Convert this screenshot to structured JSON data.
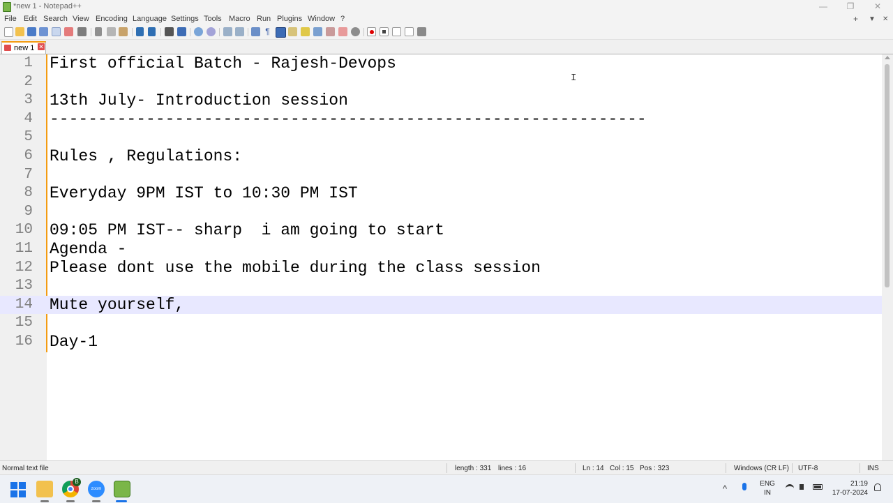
{
  "window": {
    "title": "*new 1 - Notepad++",
    "minimize": "—",
    "restore": "❐",
    "close": "✕"
  },
  "menu": {
    "items": [
      "File",
      "Edit",
      "Search",
      "View",
      "Encoding",
      "Language",
      "Settings",
      "Tools",
      "Macro",
      "Run",
      "Plugins",
      "Window",
      "?"
    ],
    "right_plus": "+",
    "right_down": "▼",
    "right_close": "✕"
  },
  "tabs": [
    {
      "label": "new 1",
      "close": "✕"
    }
  ],
  "editor": {
    "lines": [
      {
        "num": "1",
        "text": "First official Batch - Rajesh-Devops"
      },
      {
        "num": "2",
        "text": ""
      },
      {
        "num": "3",
        "text": "13th July- Introduction session"
      },
      {
        "num": "4",
        "text": "--------------------------------------------------------------"
      },
      {
        "num": "5",
        "text": ""
      },
      {
        "num": "6",
        "text": "Rules , Regulations:"
      },
      {
        "num": "7",
        "text": ""
      },
      {
        "num": "8",
        "text": "Everyday 9PM IST to 10:30 PM IST"
      },
      {
        "num": "9",
        "text": ""
      },
      {
        "num": "10",
        "text": "09:05 PM IST-- sharp  i am going to start"
      },
      {
        "num": "11",
        "text": "Agenda -"
      },
      {
        "num": "12",
        "text": "Please dont use the mobile during the class session"
      },
      {
        "num": "13",
        "text": ""
      },
      {
        "num": "14",
        "text": "Mute yourself,"
      },
      {
        "num": "15",
        "text": ""
      },
      {
        "num": "16",
        "text": "Day-1"
      }
    ],
    "current_line": 14,
    "mouse_cursor": "I"
  },
  "status": {
    "file_type": "Normal text file",
    "length": "length : 331",
    "lines": "lines : 16",
    "ln": "Ln : 14",
    "col": "Col : 15",
    "pos": "Pos : 323",
    "eol": "Windows (CR LF)",
    "encoding": "UTF-8",
    "mode": "INS"
  },
  "taskbar": {
    "lang_top": "ENG",
    "lang_bottom": "IN",
    "time": "21:19",
    "date": "17-07-2024",
    "chevron": "^",
    "chrome_badge": "B",
    "zoom_label": "zoom"
  },
  "colors": {
    "accent_tab": "#f39c12",
    "current_line": "#e8e8ff",
    "taskbar": "#eef1f6"
  }
}
